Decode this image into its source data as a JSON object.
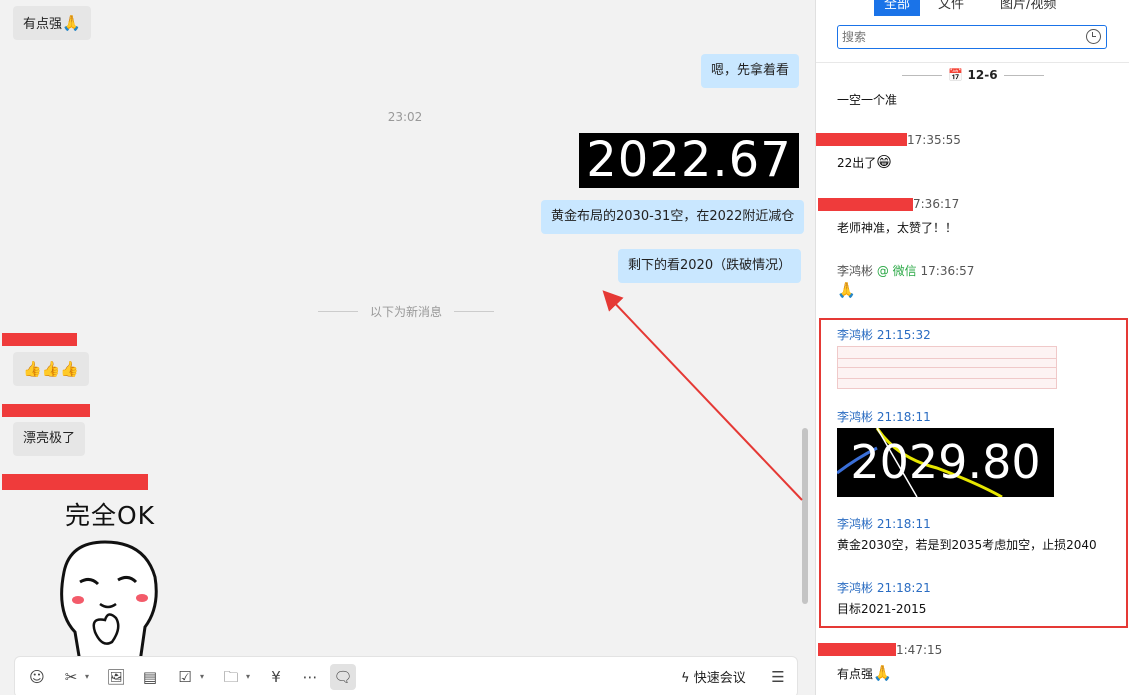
{
  "chat": {
    "messages": [
      {
        "text": "有点强",
        "emoji": "🙏"
      },
      {
        "text": "嗯，先拿着看"
      },
      {
        "text": "黄金布局的2030-31空，在2022附近减仓"
      },
      {
        "text": "剩下的看2020（跌破情况）"
      },
      {
        "text": "",
        "emoji": "👍👍👍"
      },
      {
        "text": "漂亮极了"
      }
    ],
    "timestamp": "23:02",
    "new_message_divider": "以下为新消息",
    "image_price": "2022.67",
    "sticker_caption": "完全OK"
  },
  "toolbar": {
    "icons": [
      "emoji-icon",
      "scissors-icon",
      "image-icon",
      "document-icon",
      "task-icon",
      "folder-icon",
      "yuan-icon",
      "more-icon",
      "chat-history-icon",
      "list-icon"
    ],
    "quick_meeting": "快速会议"
  },
  "side": {
    "tabs": [
      "全部",
      "文件",
      "图片/视频"
    ],
    "search_placeholder": "搜索",
    "date": "12-6",
    "items": [
      {
        "time": "",
        "text": "一空一个准"
      },
      {
        "time": "17:35:55",
        "text": "22出了",
        "emoji": "😁"
      },
      {
        "time": "7:36:17",
        "text": "老师神准，太赞了！！"
      },
      {
        "sender": "李鸿彬",
        "source": "@ 微信",
        "time": "17:36:57",
        "emoji": "🙏"
      },
      {
        "sender": "李鸿彬",
        "time": "21:15:32"
      },
      {
        "sender": "李鸿彬",
        "time": "21:18:11",
        "image_price": "2029.80"
      },
      {
        "sender": "李鸿彬",
        "time": "21:18:11",
        "text": "黄金2030空，若是到2035考虑加空，止损2040"
      },
      {
        "sender": "李鸿彬",
        "time": "21:18:21",
        "text": "目标2021-2015"
      },
      {
        "time": "1:47:15",
        "text": "有点强",
        "emoji": "🙏"
      }
    ]
  },
  "colors": {
    "accent": "#1a73e8",
    "highlight": "#e53935",
    "bubble_out": "#c9e7ff",
    "bubble_in": "#e6e6e6"
  }
}
